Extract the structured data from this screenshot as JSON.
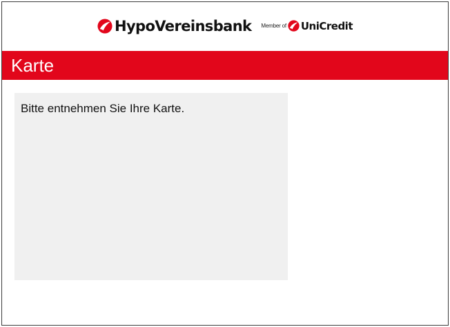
{
  "header": {
    "brand_name": "HypoVereinsbank",
    "member_of": "Member of",
    "partner_name": "UniCredit",
    "brand_icon": "unicredit-logo-icon",
    "accent_color": "#e2061b"
  },
  "title_bar": {
    "title": "Karte",
    "background_color": "#e2061b"
  },
  "message_panel": {
    "message": "Bitte entnehmen Sie Ihre Karte.",
    "background_color": "#f0f0f0"
  }
}
